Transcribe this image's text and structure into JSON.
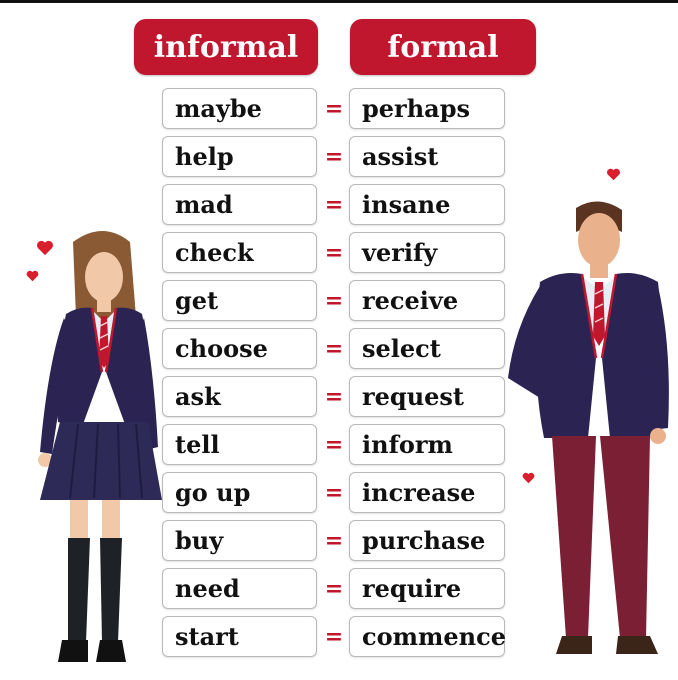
{
  "headers": {
    "informal": "informal",
    "formal": "formal"
  },
  "pairs": [
    {
      "informal": "maybe",
      "formal": "perhaps"
    },
    {
      "informal": "help",
      "formal": "assist"
    },
    {
      "informal": "mad",
      "formal": "insane"
    },
    {
      "informal": "check",
      "formal": "verify"
    },
    {
      "informal": "get",
      "formal": "receive"
    },
    {
      "informal": "choose",
      "formal": "select"
    },
    {
      "informal": "ask",
      "formal": "request"
    },
    {
      "informal": "tell",
      "formal": "inform"
    },
    {
      "informal": "go up",
      "formal": "increase"
    },
    {
      "informal": "buy",
      "formal": "purchase"
    },
    {
      "informal": "need",
      "formal": "require"
    },
    {
      "informal": "start",
      "formal": "commence"
    }
  ],
  "separator": "=",
  "colors": {
    "accent": "#c0162e",
    "blazer": "#2b2452",
    "trousers": "#7a1f34"
  },
  "illustrations": [
    "girl-in-school-uniform",
    "boy-in-school-uniform",
    "heart-icon"
  ]
}
